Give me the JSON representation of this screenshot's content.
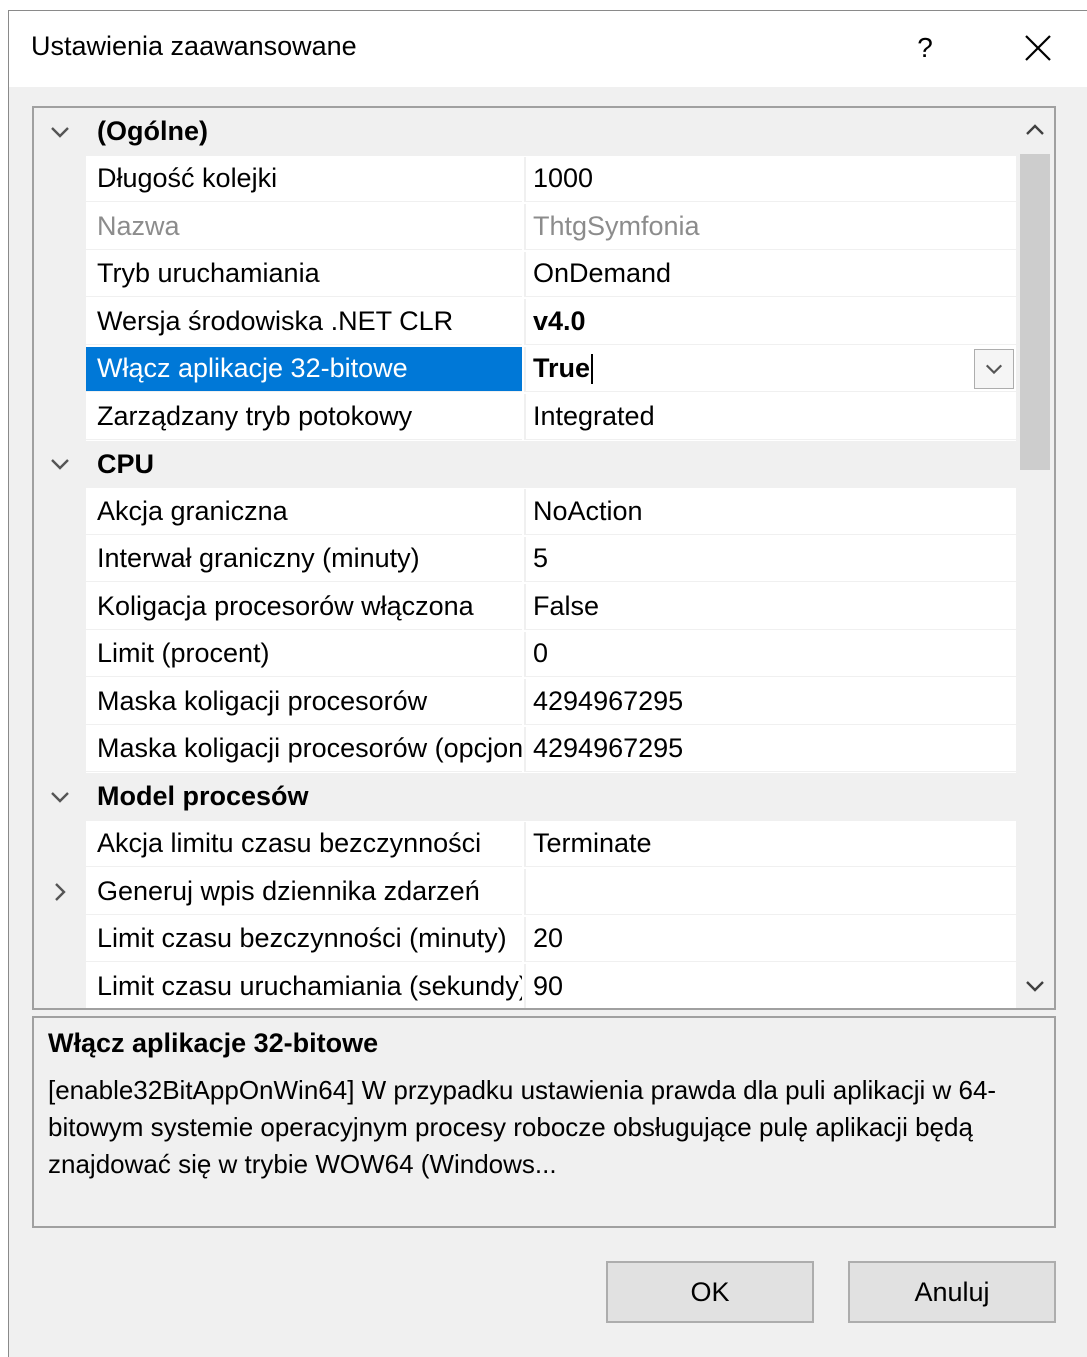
{
  "window": {
    "title": "Ustawienia zaawansowane",
    "help_label": "?"
  },
  "categories": [
    {
      "name": "(Ogólne)",
      "expanded": true,
      "properties": [
        {
          "name": "Długość kolejki",
          "value": "1000"
        },
        {
          "name": "Nazwa",
          "value": "ThtgSymfonia",
          "readonly": true
        },
        {
          "name": "Tryb uruchamiania",
          "value": "OnDemand"
        },
        {
          "name": "Wersja środowiska .NET CLR",
          "value": "v4.0",
          "bold_value": true
        },
        {
          "name": "Włącz aplikacje 32-bitowe",
          "value": "True",
          "bold_value": true,
          "selected": true,
          "has_dropdown": true
        },
        {
          "name": "Zarządzany tryb potokowy",
          "value": "Integrated"
        }
      ]
    },
    {
      "name": "CPU",
      "expanded": true,
      "properties": [
        {
          "name": "Akcja graniczna",
          "value": "NoAction"
        },
        {
          "name": "Interwał graniczny (minuty)",
          "value": "5"
        },
        {
          "name": "Koligacja procesorów włączona",
          "value": "False"
        },
        {
          "name": "Limit (procent)",
          "value": "0"
        },
        {
          "name": "Maska koligacji procesorów",
          "value": "4294967295"
        },
        {
          "name": "Maska koligacji procesorów (opcjonalna)",
          "value": "4294967295"
        }
      ]
    },
    {
      "name": "Model procesów",
      "expanded": true,
      "properties": [
        {
          "name": "Akcja limitu czasu bezczynności",
          "value": "Terminate"
        },
        {
          "name": "Generuj wpis dziennika zdarzeń ",
          "value": "",
          "expandable": true
        },
        {
          "name": "Limit czasu bezczynności (minuty)",
          "value": "20"
        },
        {
          "name": "Limit czasu uruchamiania (sekundy)",
          "value": "90"
        }
      ]
    }
  ],
  "description": {
    "title": "Włącz aplikacje 32-bitowe",
    "text": "[enable32BitAppOnWin64] W przypadku ustawienia prawda dla puli aplikacji w 64-bitowym systemie operacyjnym procesy robocze obsługujące pulę aplikacji będą znajdować się w trybie WOW64 (Windows..."
  },
  "buttons": {
    "ok": "OK",
    "cancel": "Anuluj"
  },
  "colors": {
    "selection": "#0078d7",
    "dialog_bg": "#f0f0f0",
    "readonly_text": "#8c8c8c"
  }
}
